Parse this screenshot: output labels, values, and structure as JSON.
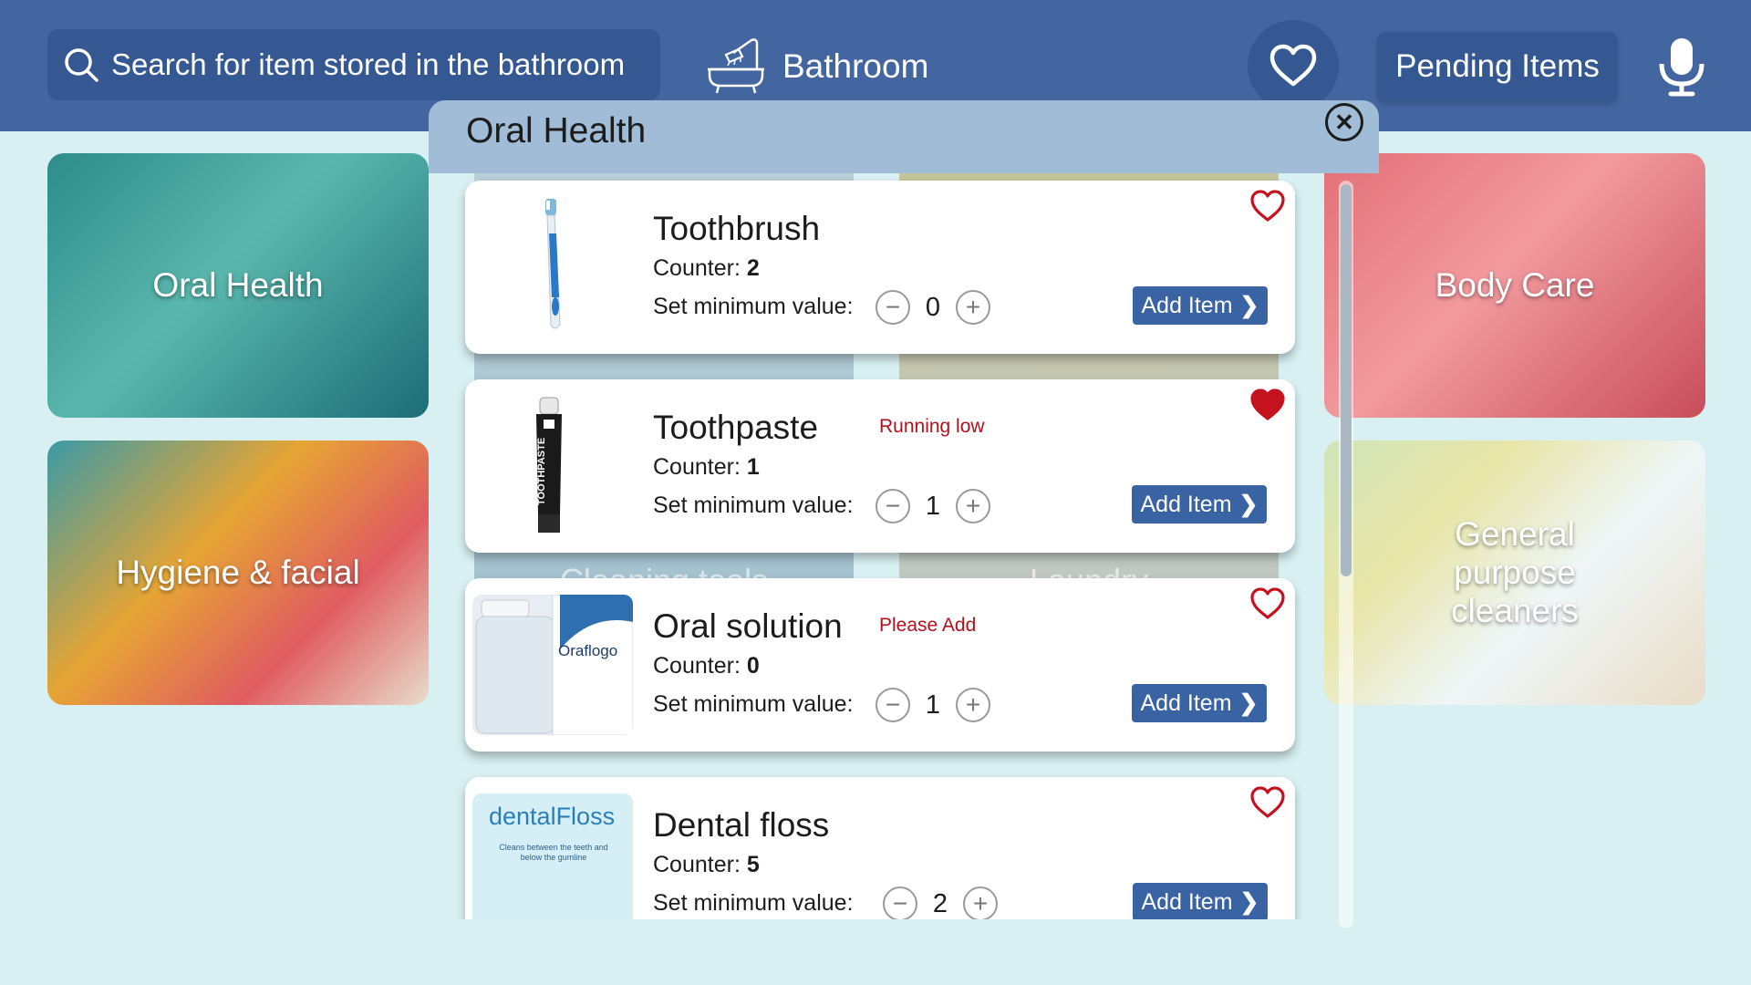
{
  "header": {
    "search_placeholder": "Search for item stored in the bathroom",
    "room_label": "Bathroom",
    "pending_label": "Pending Items"
  },
  "categories": {
    "oral_health": "Oral Health",
    "hygiene": "Hygiene & facial",
    "cleaning": "Cleaning tools",
    "laundry": "Laundry",
    "body_care": "Body Care",
    "general": "General purpose cleaners"
  },
  "panel": {
    "title": "Oral Health",
    "set_min_label": "Set minimum value:",
    "counter_label": "Counter:",
    "add_label": "Add Item",
    "items": [
      {
        "name": "Toothbrush",
        "status": "",
        "counter": "2",
        "minimum": "0",
        "favorite": false
      },
      {
        "name": "Toothpaste",
        "status": "Running low",
        "counter": "1",
        "minimum": "1",
        "favorite": true
      },
      {
        "name": "Oral solution",
        "status": "Please Add",
        "counter": "0",
        "minimum": "1",
        "favorite": false
      },
      {
        "name": "Dental floss",
        "status": "",
        "counter": "5",
        "minimum": "2",
        "favorite": false
      }
    ]
  },
  "product_labels": {
    "toothpaste_brand": "TOOTHPASTE",
    "oral_solution_brand": "Oraflogo",
    "floss_brand": "dentalFloss",
    "floss_text": "Cleans between the teeth and below the gumline"
  },
  "colors": {
    "header": "#4466a0",
    "background": "#d8f0f2",
    "accent": "#3a63a4",
    "alert": "#b3111d",
    "heart": "#c4121f"
  }
}
